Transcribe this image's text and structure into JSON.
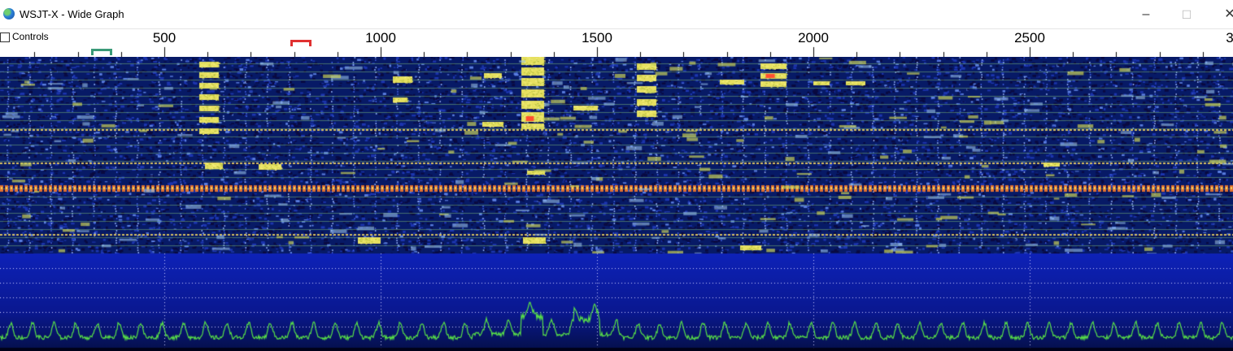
{
  "window": {
    "title": "WSJT-X - Wide Graph",
    "minimize_symbol": "–",
    "maximize_symbol": "☐",
    "close_symbol": "✕"
  },
  "controls": {
    "checkbox_label": "Controls",
    "checked": false
  },
  "scale": {
    "labels": [
      "500",
      "1000",
      "1500",
      "2000",
      "2500",
      "3"
    ],
    "freq_start_hz": 120,
    "freq_end_hz": 2980
  },
  "markers": {
    "rx_marker_hz": 355,
    "rx_color": "#3a9a78",
    "tx_marker_hz": 815,
    "tx_color": "#e03030"
  },
  "colors": {
    "waterfall_bg": "#071a66",
    "waterfall_line": "#2838c8",
    "signal": "#e6e060",
    "signal_hot": "#ff5030",
    "spectrum_bg": "#0a1aa0",
    "spectrum_line": "#58e048",
    "grid": "#c8c8ff"
  }
}
